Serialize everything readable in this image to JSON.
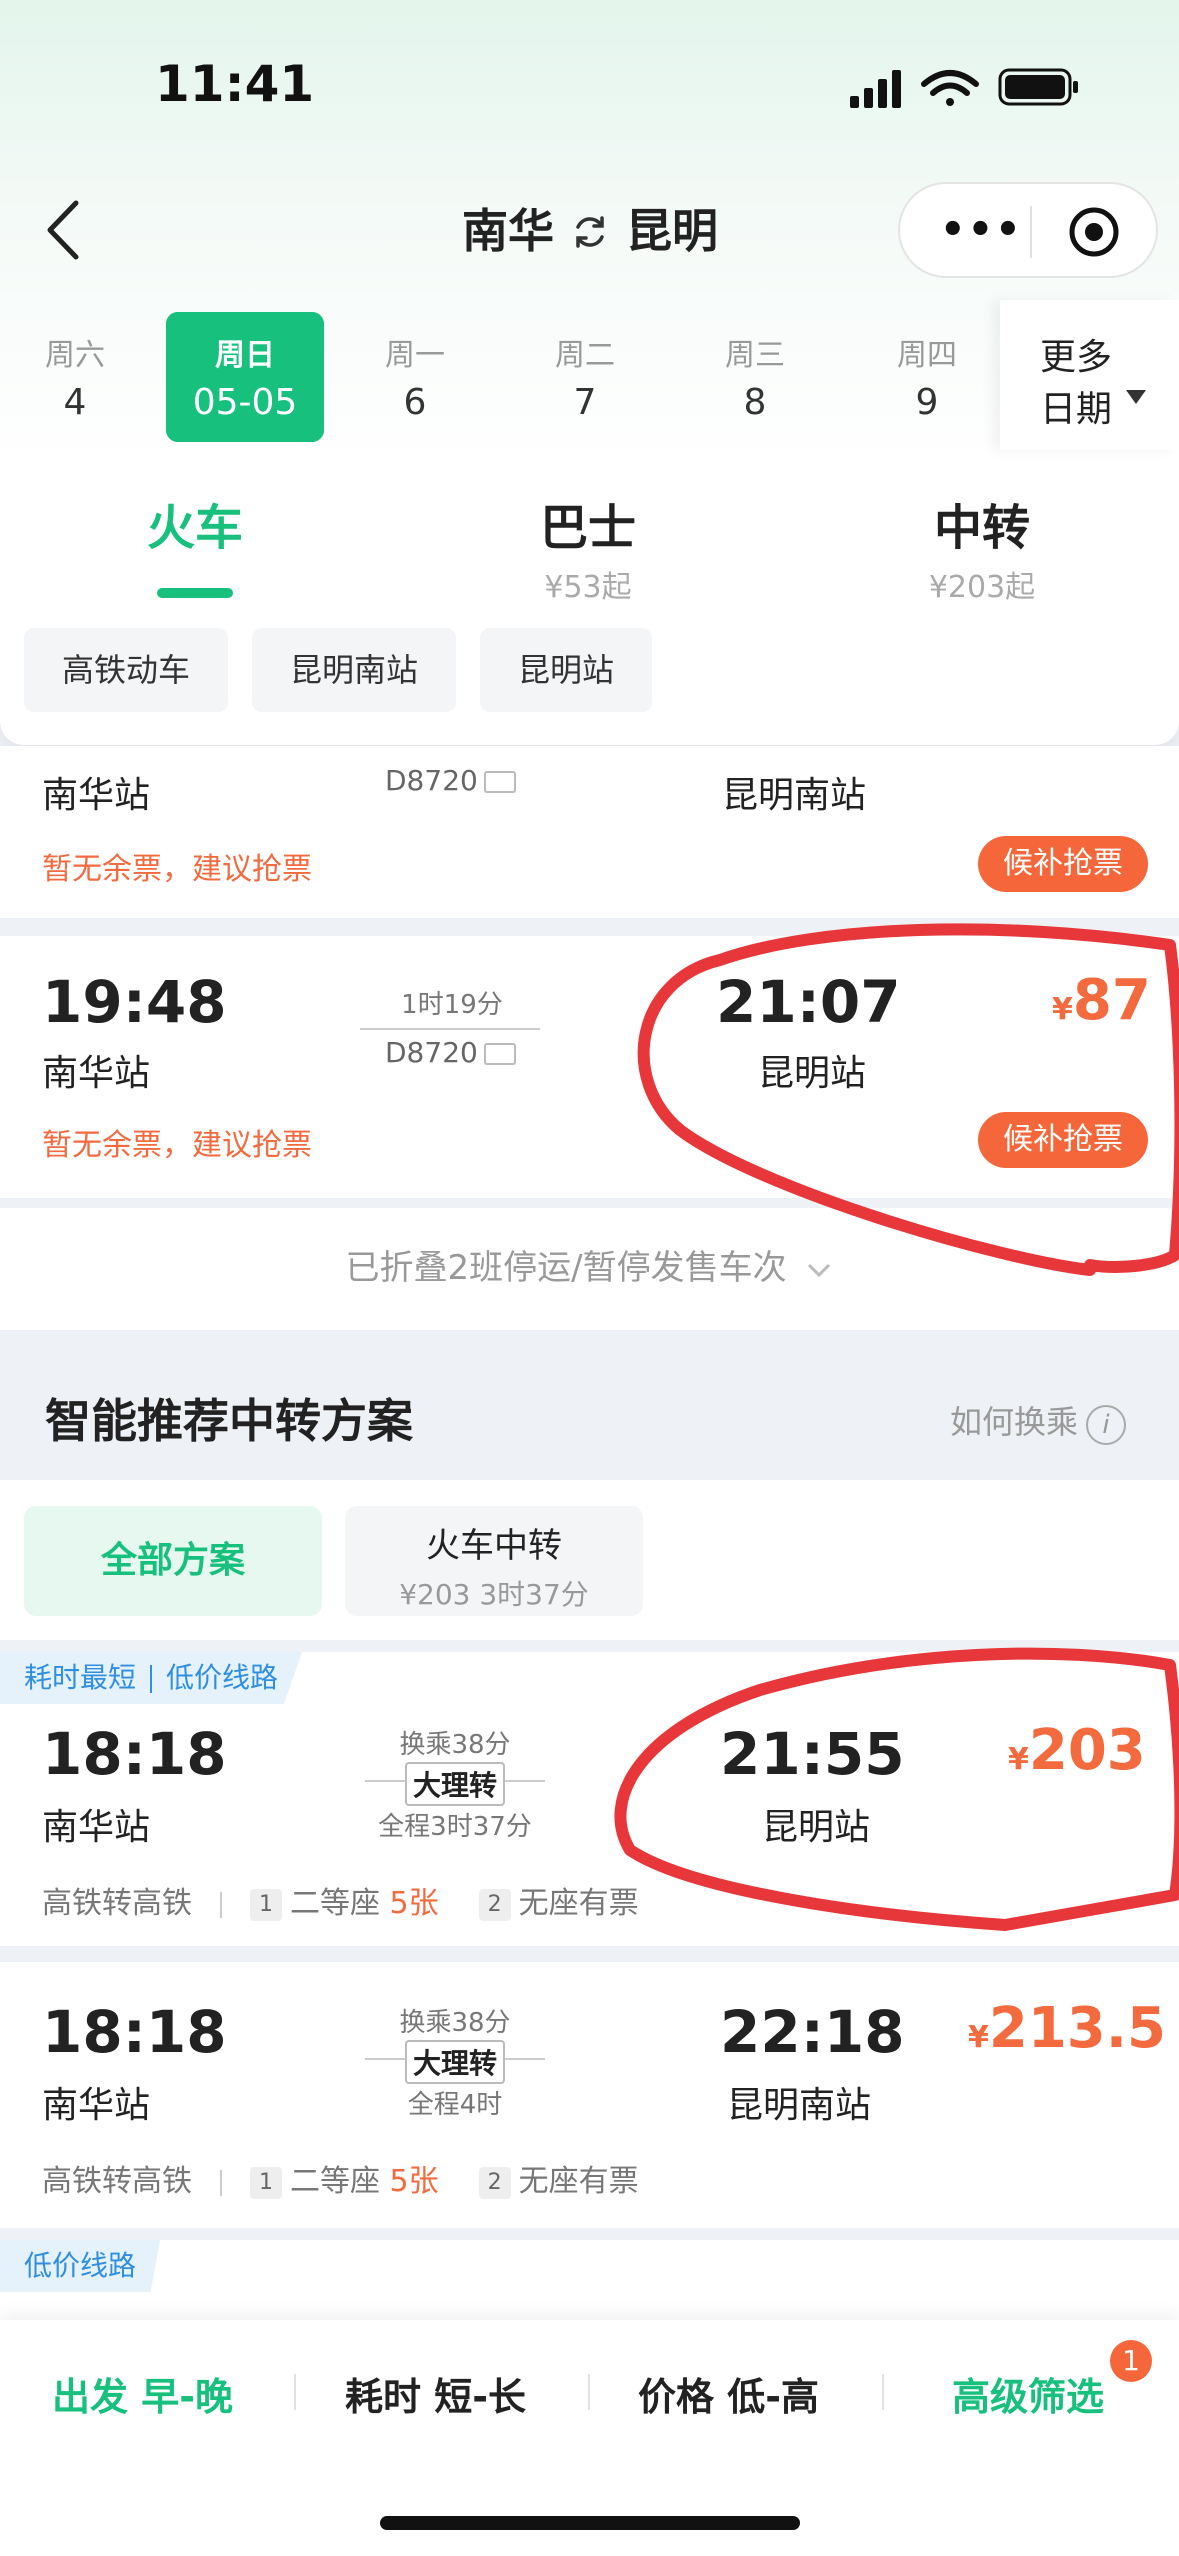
{
  "status": {
    "time": "11:41"
  },
  "nav": {
    "from": "南华",
    "to": "昆明",
    "menu": "•••"
  },
  "dates": [
    {
      "dw": "周六",
      "dn": "4"
    },
    {
      "dw": "周日",
      "dn": "05-05"
    },
    {
      "dw": "周一",
      "dn": "6"
    },
    {
      "dw": "周二",
      "dn": "7"
    },
    {
      "dw": "周三",
      "dn": "8"
    },
    {
      "dw": "周四",
      "dn": "9"
    }
  ],
  "more_date": {
    "line1": "更多",
    "line2": "日期"
  },
  "tabs": [
    {
      "label": "火车",
      "sub": ""
    },
    {
      "label": "巴士",
      "sub": "¥53起"
    },
    {
      "label": "中转",
      "sub": "¥203起"
    }
  ],
  "chips": [
    "高铁动车",
    "昆明南站",
    "昆明站"
  ],
  "trains": [
    {
      "dep_station": "南华站",
      "train_no": "D8720",
      "arr_station": "昆明南站",
      "status": "暂无余票，建议抢票",
      "action": "候补抢票"
    },
    {
      "dep_time": "19:48",
      "dep_station": "南华站",
      "duration": "1时19分",
      "train_no": "D8720",
      "arr_time": "21:07",
      "arr_station": "昆明站",
      "currency": "¥",
      "price": "87",
      "status": "暂无余票，建议抢票",
      "action": "候补抢票"
    }
  ],
  "fold_text": "已折叠2班停运/暂停发售车次",
  "transfer_section": {
    "title": "智能推荐中转方案",
    "help": "如何换乘",
    "help_icon": "i",
    "tab_all": "全部方案",
    "tab_train_title": "火车中转",
    "tab_train_sub": "¥203 3时37分"
  },
  "transfers": [
    {
      "tag1": "耗时最短",
      "tag2": "低价线路",
      "dep_time": "18:18",
      "dep_station": "南华站",
      "wait": "换乘38分",
      "via": "大理转",
      "total": "全程3时37分",
      "arr_time": "21:55",
      "arr_station": "昆明站",
      "currency": "¥",
      "price": "203",
      "type": "高铁转高铁",
      "seg1_num": "1",
      "seg1_seat": "二等座",
      "seg1_count": "5张",
      "seg2_num": "2",
      "seg2_seat": "无座有票"
    },
    {
      "dep_time": "18:18",
      "dep_station": "南华站",
      "wait": "换乘38分",
      "via": "大理转",
      "total": "全程4时",
      "arr_time": "22:18",
      "arr_station": "昆明南站",
      "currency": "¥",
      "price": "213.5",
      "type": "高铁转高铁",
      "seg1_num": "1",
      "seg1_seat": "二等座",
      "seg1_count": "5张",
      "seg2_num": "2",
      "seg2_seat": "无座有票"
    }
  ],
  "third_tag": "低价线路",
  "filters": {
    "depart": "出发 早-晚",
    "duration": "耗时 短-长",
    "price": "价格 低-高",
    "advanced": "高级筛选",
    "badge": "1"
  },
  "colors": {
    "accent_green": "#17c07c",
    "price_orange": "#f26a3d",
    "tag_blue": "#2f8fe0",
    "annotation_red": "#e8373a"
  }
}
